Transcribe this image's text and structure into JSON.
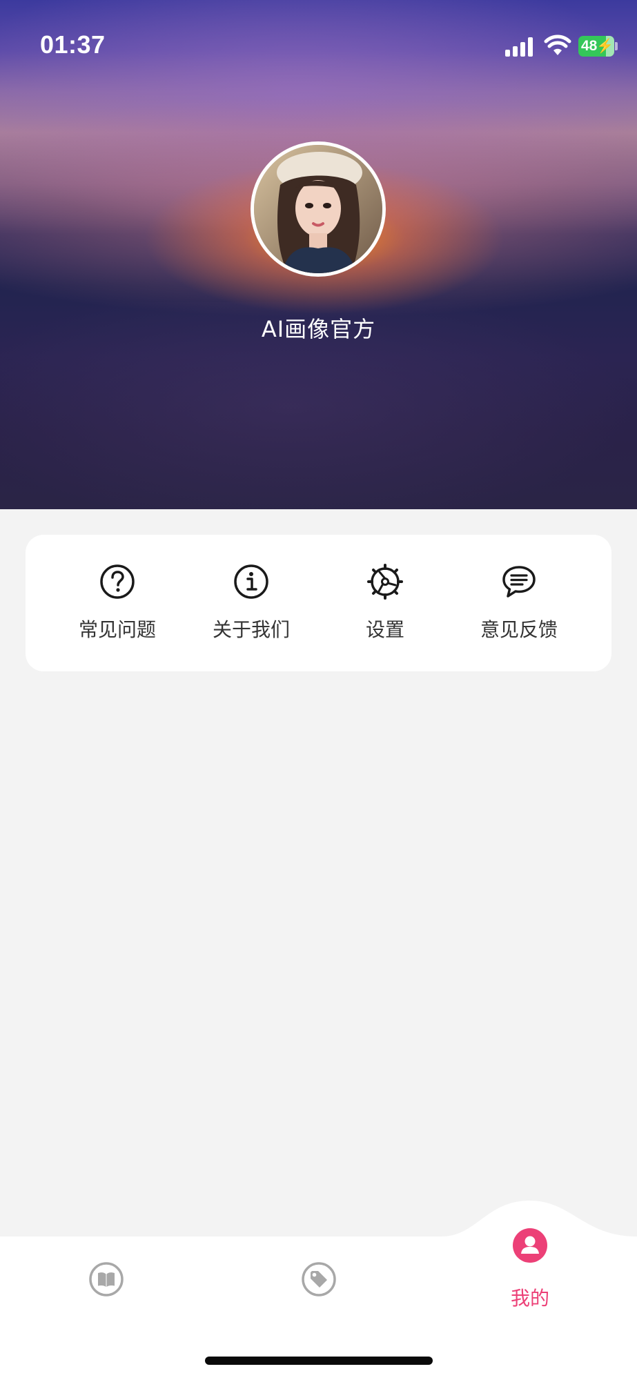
{
  "status_bar": {
    "time": "01:37",
    "battery_level": "48",
    "icons": [
      "cellular-signal-icon",
      "wifi-icon",
      "battery-charging-icon"
    ]
  },
  "profile": {
    "name": "AI画像官方",
    "avatar_icon": "user-avatar-photo"
  },
  "quick_actions": [
    {
      "label": "常见问题",
      "icon": "question-circle-icon"
    },
    {
      "label": "关于我们",
      "icon": "info-circle-icon"
    },
    {
      "label": "设置",
      "icon": "settings-gear-icon"
    },
    {
      "label": "意见反馈",
      "icon": "message-bubble-icon"
    }
  ],
  "tabbar": {
    "tabs": [
      {
        "icon": "book-icon",
        "label": ""
      },
      {
        "icon": "tag-icon",
        "label": ""
      },
      {
        "icon": "user-icon",
        "label": "我的",
        "active": true
      }
    ],
    "active_color": "#ec4077",
    "inactive_color": "#a8a8a8"
  },
  "colors": {
    "page_background": "#f3f3f3",
    "card_background": "#ffffff",
    "accent": "#ec4077"
  }
}
